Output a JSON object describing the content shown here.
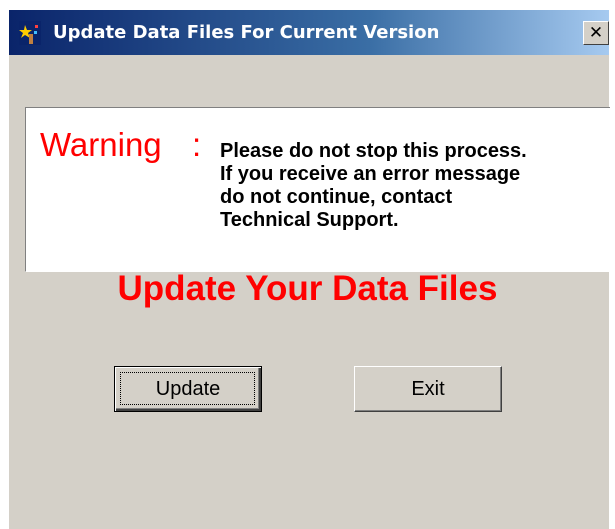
{
  "window": {
    "title": "Update Data Files For Current Version",
    "close_glyph": "✕",
    "title_gradient_start": "#0a246a",
    "title_gradient_end": "#a6caf0",
    "face_color": "#d4d0c8",
    "app_icon": "wizard-icon"
  },
  "warning": {
    "label": "Warning",
    "colon": ":",
    "label_color": "#ff0000",
    "message_lines": [
      "Please do not stop this process.",
      "If you receive an error message",
      "do not continue, contact",
      "Technical Support."
    ]
  },
  "headline": {
    "text": "Update Your Data Files",
    "color": "#ff0000"
  },
  "buttons": {
    "update_label": "Update",
    "exit_label": "Exit"
  }
}
